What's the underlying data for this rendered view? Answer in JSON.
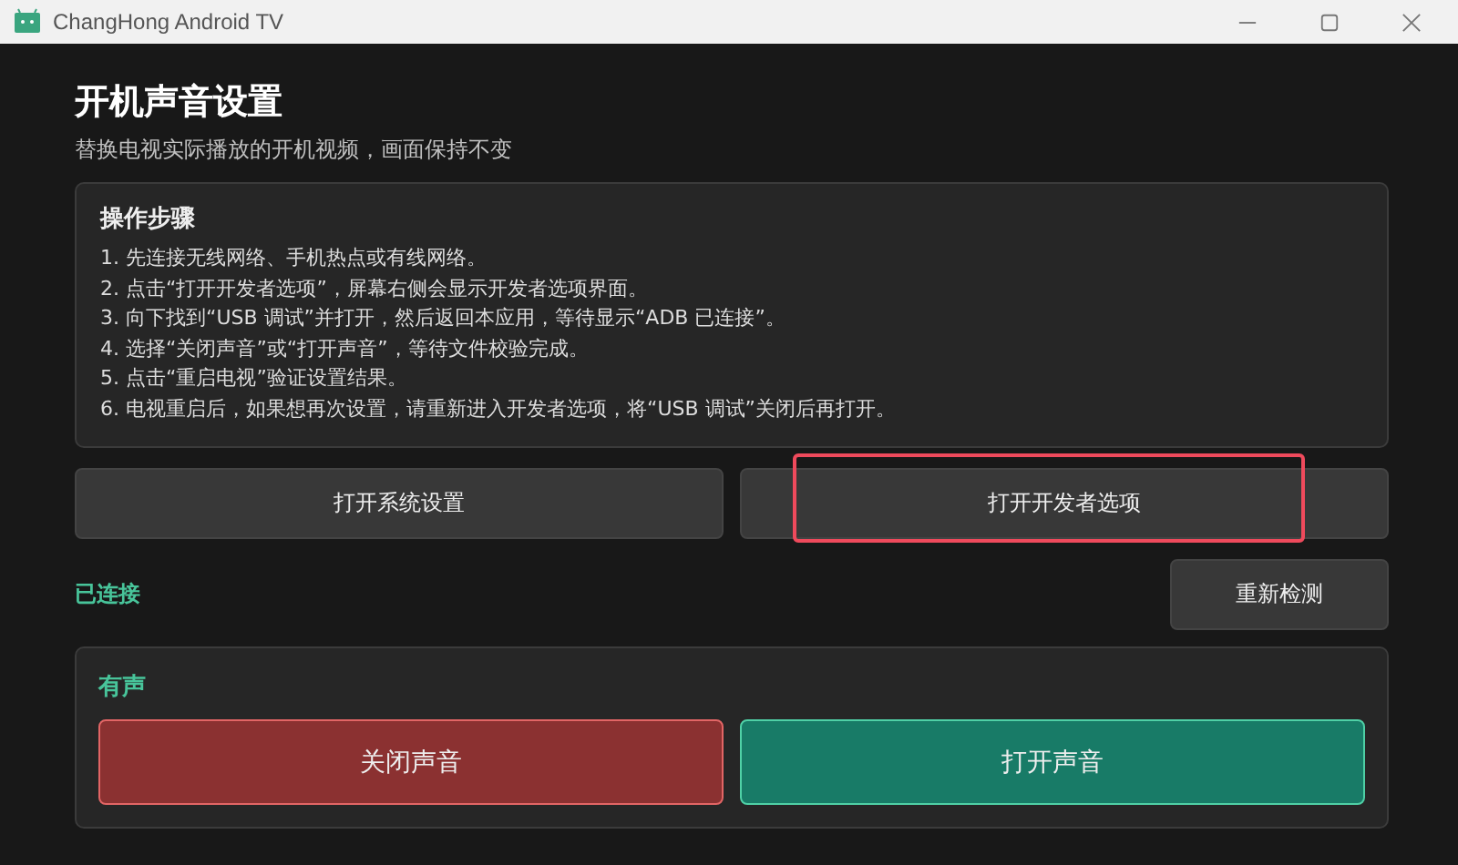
{
  "window": {
    "title": "ChangHong Android TV"
  },
  "header": {
    "title": "开机声音设置",
    "subtitle": "替换电视实际播放的开机视频，画面保持不变"
  },
  "steps": {
    "title": "操作步骤",
    "items": [
      "1. 先连接无线网络、手机热点或有线网络。",
      "2. 点击“打开开发者选项”，屏幕右侧会显示开发者选项界面。",
      "3. 向下找到“USB 调试”并打开，然后返回本应用，等待显示“ADB 已连接”。",
      "4. 选择“关闭声音”或“打开声音”，等待文件校验完成。",
      "5. 点击“重启电视”验证设置结果。",
      "6. 电视重启后，如果想再次设置，请重新进入开发者选项，将“USB 调试”关闭后再打开。"
    ]
  },
  "actions": [
    {
      "label": "打开系统设置",
      "highlighted": false
    },
    {
      "label": "打开开发者选项",
      "highlighted": true
    }
  ],
  "status": {
    "text": "已连接",
    "connected": true,
    "button": "重新检测"
  },
  "sound": {
    "title": "有声",
    "buttons": [
      {
        "label": "关闭声音",
        "kind": "off"
      },
      {
        "label": "打开声音",
        "kind": "on"
      }
    ]
  }
}
